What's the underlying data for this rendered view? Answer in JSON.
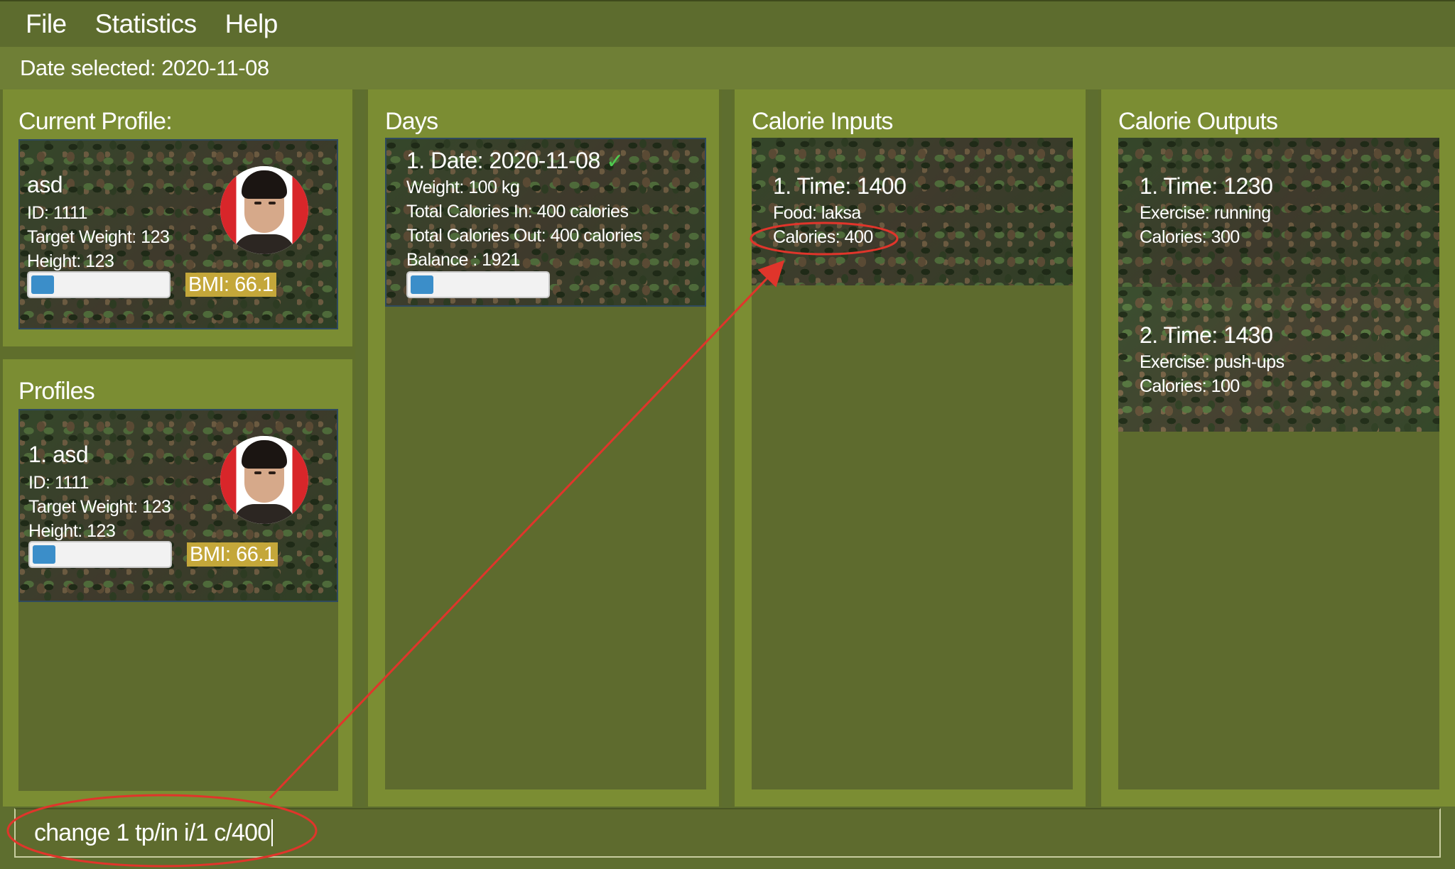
{
  "menu": {
    "items": [
      "File",
      "Statistics",
      "Help"
    ]
  },
  "date_bar": {
    "label": "Date selected: 2020-11-08"
  },
  "current_profile": {
    "title": "Current Profile:",
    "name": "asd",
    "id": "ID: 1111",
    "target_weight": "Target Weight: 123",
    "height": "Height: 123",
    "progress": 0.2,
    "bmi": "BMI: 66.1"
  },
  "profiles": {
    "title": "Profiles",
    "items": [
      {
        "name": "1.  asd",
        "id": "ID: 1111",
        "target_weight": "Target Weight: 123",
        "height": "Height: 123",
        "progress": 0.2,
        "bmi": "BMI: 66.1"
      }
    ]
  },
  "days": {
    "title": "Days",
    "items": [
      {
        "date": "1.  Date: 2020-11-08",
        "check": "✓",
        "weight": "Weight: 100 kg",
        "calories_in": "Total Calories In: 400 calories",
        "calories_out": "Total Calories Out: 400 calories",
        "balance": "Balance : 1921",
        "progress": 0.2
      }
    ]
  },
  "calorie_inputs": {
    "title": "Calorie Inputs",
    "items": [
      {
        "time": "1.  Time: 1400",
        "food": "Food: laksa",
        "calories": "Calories: 400"
      }
    ]
  },
  "calorie_outputs": {
    "title": "Calorie Outputs",
    "items": [
      {
        "time": "1.  Time: 1230",
        "exercise": "Exercise: running",
        "calories": "Calories: 300"
      },
      {
        "time": "2.  Time: 1430",
        "exercise": "Exercise: push-ups",
        "calories": "Calories: 100"
      }
    ]
  },
  "command": {
    "value": "change 1 tp/in i/1 c/400"
  },
  "colors": {
    "background": "#5e6e2f",
    "panel": "#7b8d33",
    "annotation": "#e0352b",
    "progress_fill": "#3b8ec9",
    "bmi_badge": "#c4a73a",
    "check": "#4fca4f"
  },
  "icons": {
    "day_check": "check-icon"
  }
}
